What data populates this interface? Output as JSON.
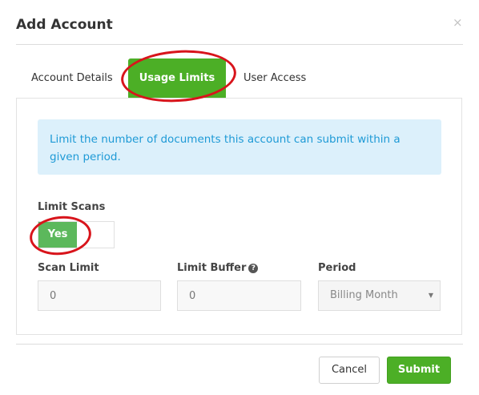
{
  "dialog": {
    "title": "Add Account",
    "close_glyph": "×"
  },
  "tabs": [
    {
      "label": "Account Details",
      "active": false
    },
    {
      "label": "Usage Limits",
      "active": true
    },
    {
      "label": "User Access",
      "active": false
    }
  ],
  "info": {
    "text": "Limit the number of documents this account can submit within a given period."
  },
  "limit_scans": {
    "label": "Limit Scans",
    "toggle_on_label": "Yes",
    "value": "Yes"
  },
  "scan_limit": {
    "label": "Scan Limit",
    "value": "0"
  },
  "limit_buffer": {
    "label": "Limit Buffer",
    "help_icon": "question-circle-icon",
    "help_glyph": "?",
    "value": "0"
  },
  "period": {
    "label": "Period",
    "selected": "Billing Month",
    "caret_glyph": "▼"
  },
  "footer": {
    "cancel_label": "Cancel",
    "submit_label": "Submit"
  },
  "colors": {
    "accent_green": "#4caf26",
    "toggle_green": "#5cb85c",
    "info_bg": "#dcf0fb",
    "info_text": "#1e9ad6",
    "annotation_red": "#d8141b"
  }
}
